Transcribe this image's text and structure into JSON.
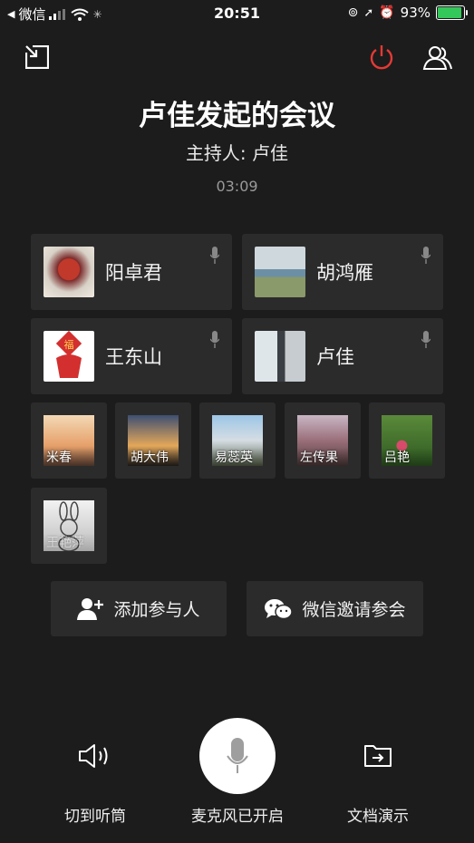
{
  "status_bar": {
    "back_app": "微信",
    "time": "20:51",
    "battery_percent": "93%",
    "battery_level": 0.93,
    "battery_color": "#34c759"
  },
  "toolbar": {
    "minimize_icon": "minimize-window-icon",
    "end_icon": "power-icon",
    "end_icon_color": "#e53935",
    "members_icon": "members-icon"
  },
  "meeting": {
    "title": "卢佳发起的会议",
    "host": "主持人: 卢佳",
    "duration": "03:09"
  },
  "speakers": [
    {
      "name": "阳卓君"
    },
    {
      "name": "胡鸿雁"
    },
    {
      "name": "王东山"
    },
    {
      "name": "卢佳"
    }
  ],
  "participants": [
    {
      "name": "米春"
    },
    {
      "name": "胡大伟"
    },
    {
      "name": "易蕊英"
    },
    {
      "name": "左传果"
    },
    {
      "name": "吕艳"
    },
    {
      "name": "王艳萍"
    }
  ],
  "actions": {
    "add_participant": "添加参与人",
    "wechat_invite": "微信邀请参会"
  },
  "controls": {
    "earpiece": "切到听筒",
    "mic_status": "麦克风已开启",
    "doc_share": "文档演示"
  }
}
